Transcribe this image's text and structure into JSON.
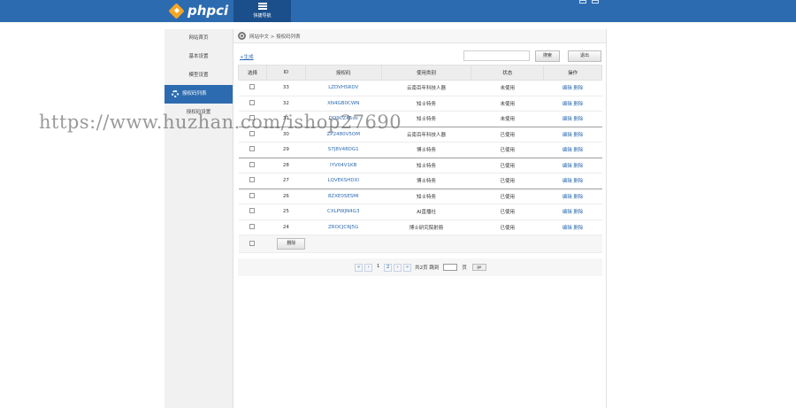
{
  "header": {
    "logo_mark": "◆",
    "logo_text": "phpci",
    "nav_tab_label": "快捷导航"
  },
  "sidebar": {
    "items": [
      {
        "label": "网站首页",
        "active": false
      },
      {
        "label": "基本设置",
        "active": false
      },
      {
        "label": "模型设置",
        "active": false
      },
      {
        "label": "授权码列表",
        "active": true,
        "icon": "gear-icon"
      },
      {
        "label": "授权码设置",
        "active": false
      }
    ]
  },
  "breadcrumb": {
    "text": "网站中文 > 授权码列表"
  },
  "toolbar": {
    "add_label": "+生成",
    "search_placeholder": "",
    "search_label": "搜索",
    "exit_label": "退出"
  },
  "table": {
    "headers": [
      "选择",
      "ID",
      "授权码",
      "使用类别",
      "状态",
      "操作"
    ],
    "rows": [
      {
        "id": "33",
        "code": "LZDVHSRDV",
        "category": "云南百年科技人器",
        "status": "未使用",
        "ops": "编辑 删除"
      },
      {
        "id": "32",
        "code": "XN4GB0CWN",
        "category": "知士特务",
        "status": "未使用",
        "ops": "编辑 删除"
      },
      {
        "id": "31",
        "code": "DQ9CZK5us",
        "category": "知士特务",
        "status": "未使用",
        "ops": "编辑 删除"
      },
      {
        "id": "30",
        "code": "ZP2480V5OM",
        "category": "云南百年科技人器",
        "status": "已使用",
        "ops": "编辑 删除"
      },
      {
        "id": "29",
        "code": "S7J8V48DG1",
        "category": "博士特务",
        "status": "已使用",
        "ops": "编辑 删除"
      },
      {
        "id": "28",
        "code": "IYV04V1KB",
        "category": "知士特务",
        "status": "已使用",
        "ops": "编辑 删除"
      },
      {
        "id": "27",
        "code": "LQVEKSHDXI",
        "category": "博士特务",
        "status": "已使用",
        "ops": "编辑 删除"
      },
      {
        "id": "26",
        "code": "8ZXE0SESMI",
        "category": "知士特务",
        "status": "已使用",
        "ops": "编辑 删除"
      },
      {
        "id": "25",
        "code": "CXLPWJN4G3",
        "category": "AI直播社",
        "status": "已使用",
        "ops": "编辑 删除"
      },
      {
        "id": "24",
        "code": "ZROCJCRJ5G",
        "category": "博士研究院射箭",
        "status": "已使用",
        "ops": "编辑 删除"
      }
    ],
    "delete_label": "删除"
  },
  "pagination": {
    "first": "«",
    "prev": "‹",
    "pages": [
      "1",
      "2"
    ],
    "current": "1",
    "next": "›",
    "last": "»",
    "summary": "共2页 跳到",
    "page_unit": "页",
    "go_label": "go"
  },
  "watermark": "https://www.huzhan.com/ishop27690"
}
